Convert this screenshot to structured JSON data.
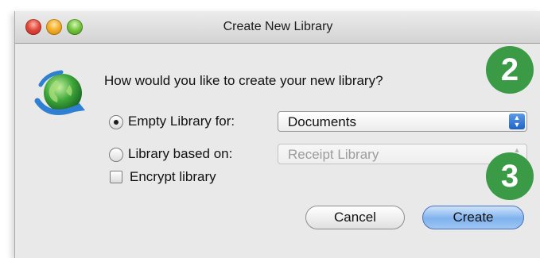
{
  "window": {
    "title": "Create New Library"
  },
  "dialog": {
    "question": "How would you like to create your new library?",
    "options": [
      {
        "label": "Empty Library for:",
        "selected": true
      },
      {
        "label": "Library based on:",
        "selected": false
      }
    ],
    "empty_library_select": {
      "value": "Documents",
      "enabled": true
    },
    "based_on_select": {
      "value": "Receipt Library",
      "enabled": false
    },
    "encrypt": {
      "label": "Encrypt library",
      "checked": false
    },
    "buttons": {
      "cancel": "Cancel",
      "create": "Create"
    }
  },
  "badges": [
    "2",
    "3"
  ],
  "icons": {
    "app": "globe-sync-icon",
    "select_arrows": "up-down-arrows-icon"
  },
  "colors": {
    "badge": "#3b9a45",
    "default_button": "#7fb2ee",
    "select_accent": "#1f63c6"
  }
}
